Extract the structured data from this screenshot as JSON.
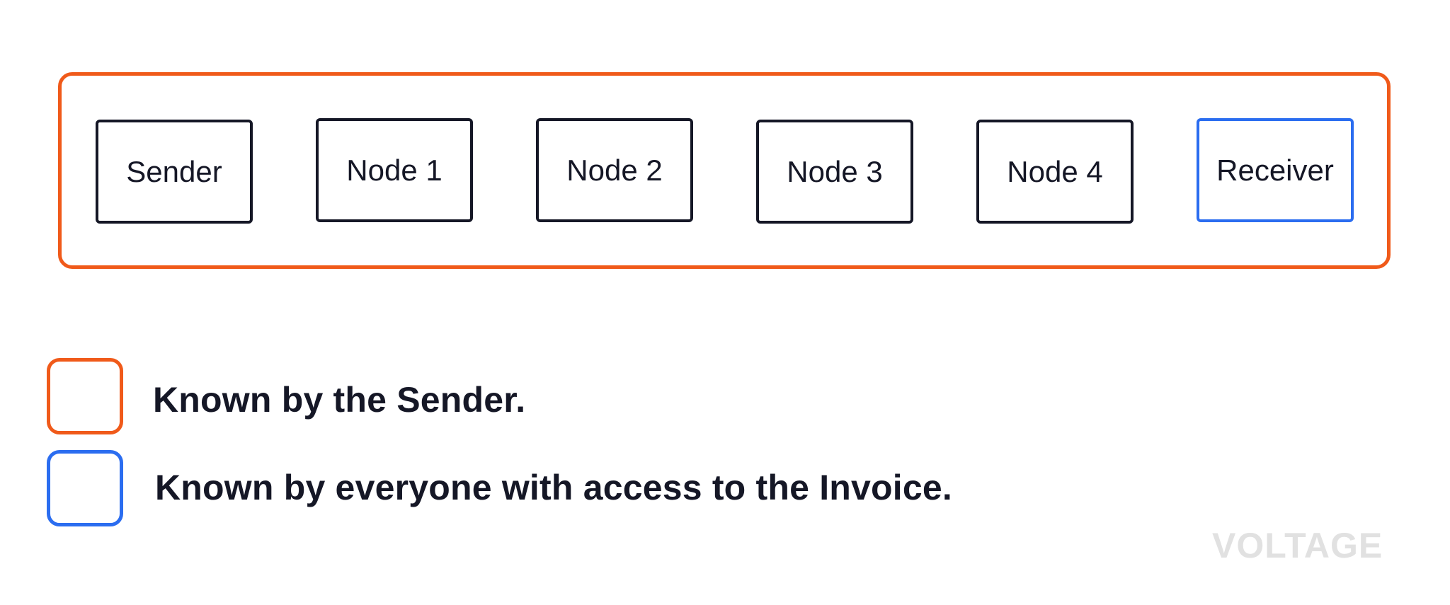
{
  "nodes": [
    {
      "label": "Sender",
      "role": "hop"
    },
    {
      "label": "Node 1",
      "role": "hop"
    },
    {
      "label": "Node 2",
      "role": "hop"
    },
    {
      "label": "Node 3",
      "role": "hop"
    },
    {
      "label": "Node 4",
      "role": "hop"
    },
    {
      "label": "Receiver",
      "role": "receiver"
    }
  ],
  "legend": [
    {
      "label": "Known by the Sender.",
      "color": "#f05a1a"
    },
    {
      "label": "Known by everyone with access to the Invoice.",
      "color": "#2b6df0"
    }
  ],
  "colors": {
    "sender_known": "#f05a1a",
    "invoice_known": "#2b6df0",
    "node_border": "#151726",
    "logo": "#e1e1e1"
  },
  "logo": {
    "text": "VOLTAGE"
  }
}
